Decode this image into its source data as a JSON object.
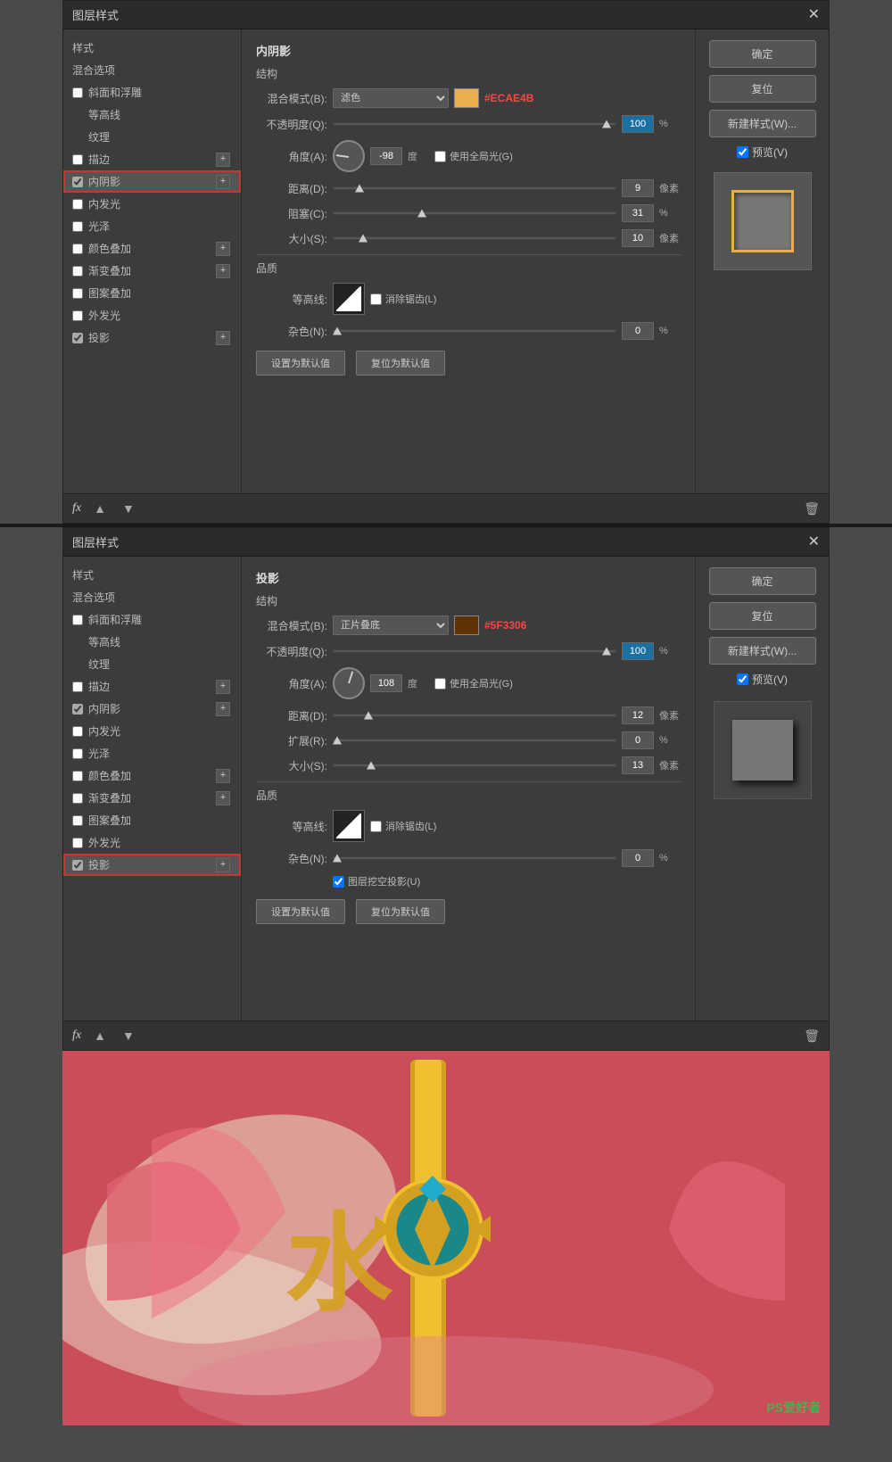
{
  "dialog1": {
    "title": "图层样式",
    "section": "内阴影",
    "struct_label": "结构",
    "quality_label": "品质",
    "blend_mode_label": "混合模式(B):",
    "blend_mode_value": "滤色",
    "opacity_label": "不透明度(Q):",
    "opacity_value": "100",
    "opacity_unit": "%",
    "angle_label": "角度(A):",
    "angle_value": "-98",
    "angle_unit": "度",
    "use_global_light": "使用全局光(G)",
    "distance_label": "距离(D):",
    "distance_value": "9",
    "distance_unit": "像素",
    "choke_label": "阻塞(C):",
    "choke_value": "31",
    "choke_unit": "%",
    "size_label": "大小(S):",
    "size_value": "10",
    "size_unit": "像素",
    "contour_label": "等高线:",
    "anti_alias": "消除锯齿(L)",
    "noise_label": "杂色(N):",
    "noise_value": "0",
    "noise_unit": "%",
    "set_default": "设置为默认值",
    "reset_default": "复位为默认值",
    "color_hex": "#ECAE4B",
    "color_hex_display": "#ECAE4B",
    "confirm_btn": "确定",
    "reset_btn": "复位",
    "new_style_btn": "新建样式(W)...",
    "preview_label": "预览(V)"
  },
  "dialog2": {
    "title": "图层样式",
    "section": "投影",
    "struct_label": "结构",
    "quality_label": "品质",
    "blend_mode_label": "混合模式(B):",
    "blend_mode_value": "正片叠底",
    "opacity_label": "不透明度(Q):",
    "opacity_value": "100",
    "opacity_unit": "%",
    "angle_label": "角度(A):",
    "angle_value": "108",
    "angle_unit": "度",
    "use_global_light": "使用全局光(G)",
    "distance_label": "距离(D):",
    "distance_value": "12",
    "distance_unit": "像素",
    "spread_label": "扩展(R):",
    "spread_value": "0",
    "spread_unit": "%",
    "size_label": "大小(S):",
    "size_value": "13",
    "size_unit": "像素",
    "contour_label": "等高线:",
    "anti_alias": "消除锯齿(L)",
    "noise_label": "杂色(N):",
    "noise_value": "0",
    "noise_unit": "%",
    "layer_knockout": "图层挖空投影(U)",
    "set_default": "设置为默认值",
    "reset_default": "复位为默认值",
    "color_hex": "#5F3306",
    "color_hex_display": "#5F3306",
    "confirm_btn": "确定",
    "reset_btn": "复位",
    "new_style_btn": "新建样式(W)...",
    "preview_label": "预览(V)"
  },
  "sidebar1": {
    "style_label": "样式",
    "blend_label": "混合选项",
    "bevel_label": "斜面和浮雕",
    "contour_label": "等高线",
    "texture_label": "纹理",
    "stroke_label": "描边",
    "inner_shadow_label": "内阴影",
    "inner_glow_label": "内发光",
    "satin_label": "光泽",
    "color_overlay_label": "颜色叠加",
    "gradient_overlay_label": "渐变叠加",
    "pattern_overlay_label": "图案叠加",
    "outer_glow_label": "外发光",
    "drop_shadow_label": "投影"
  },
  "watermark": "PS爱好者"
}
